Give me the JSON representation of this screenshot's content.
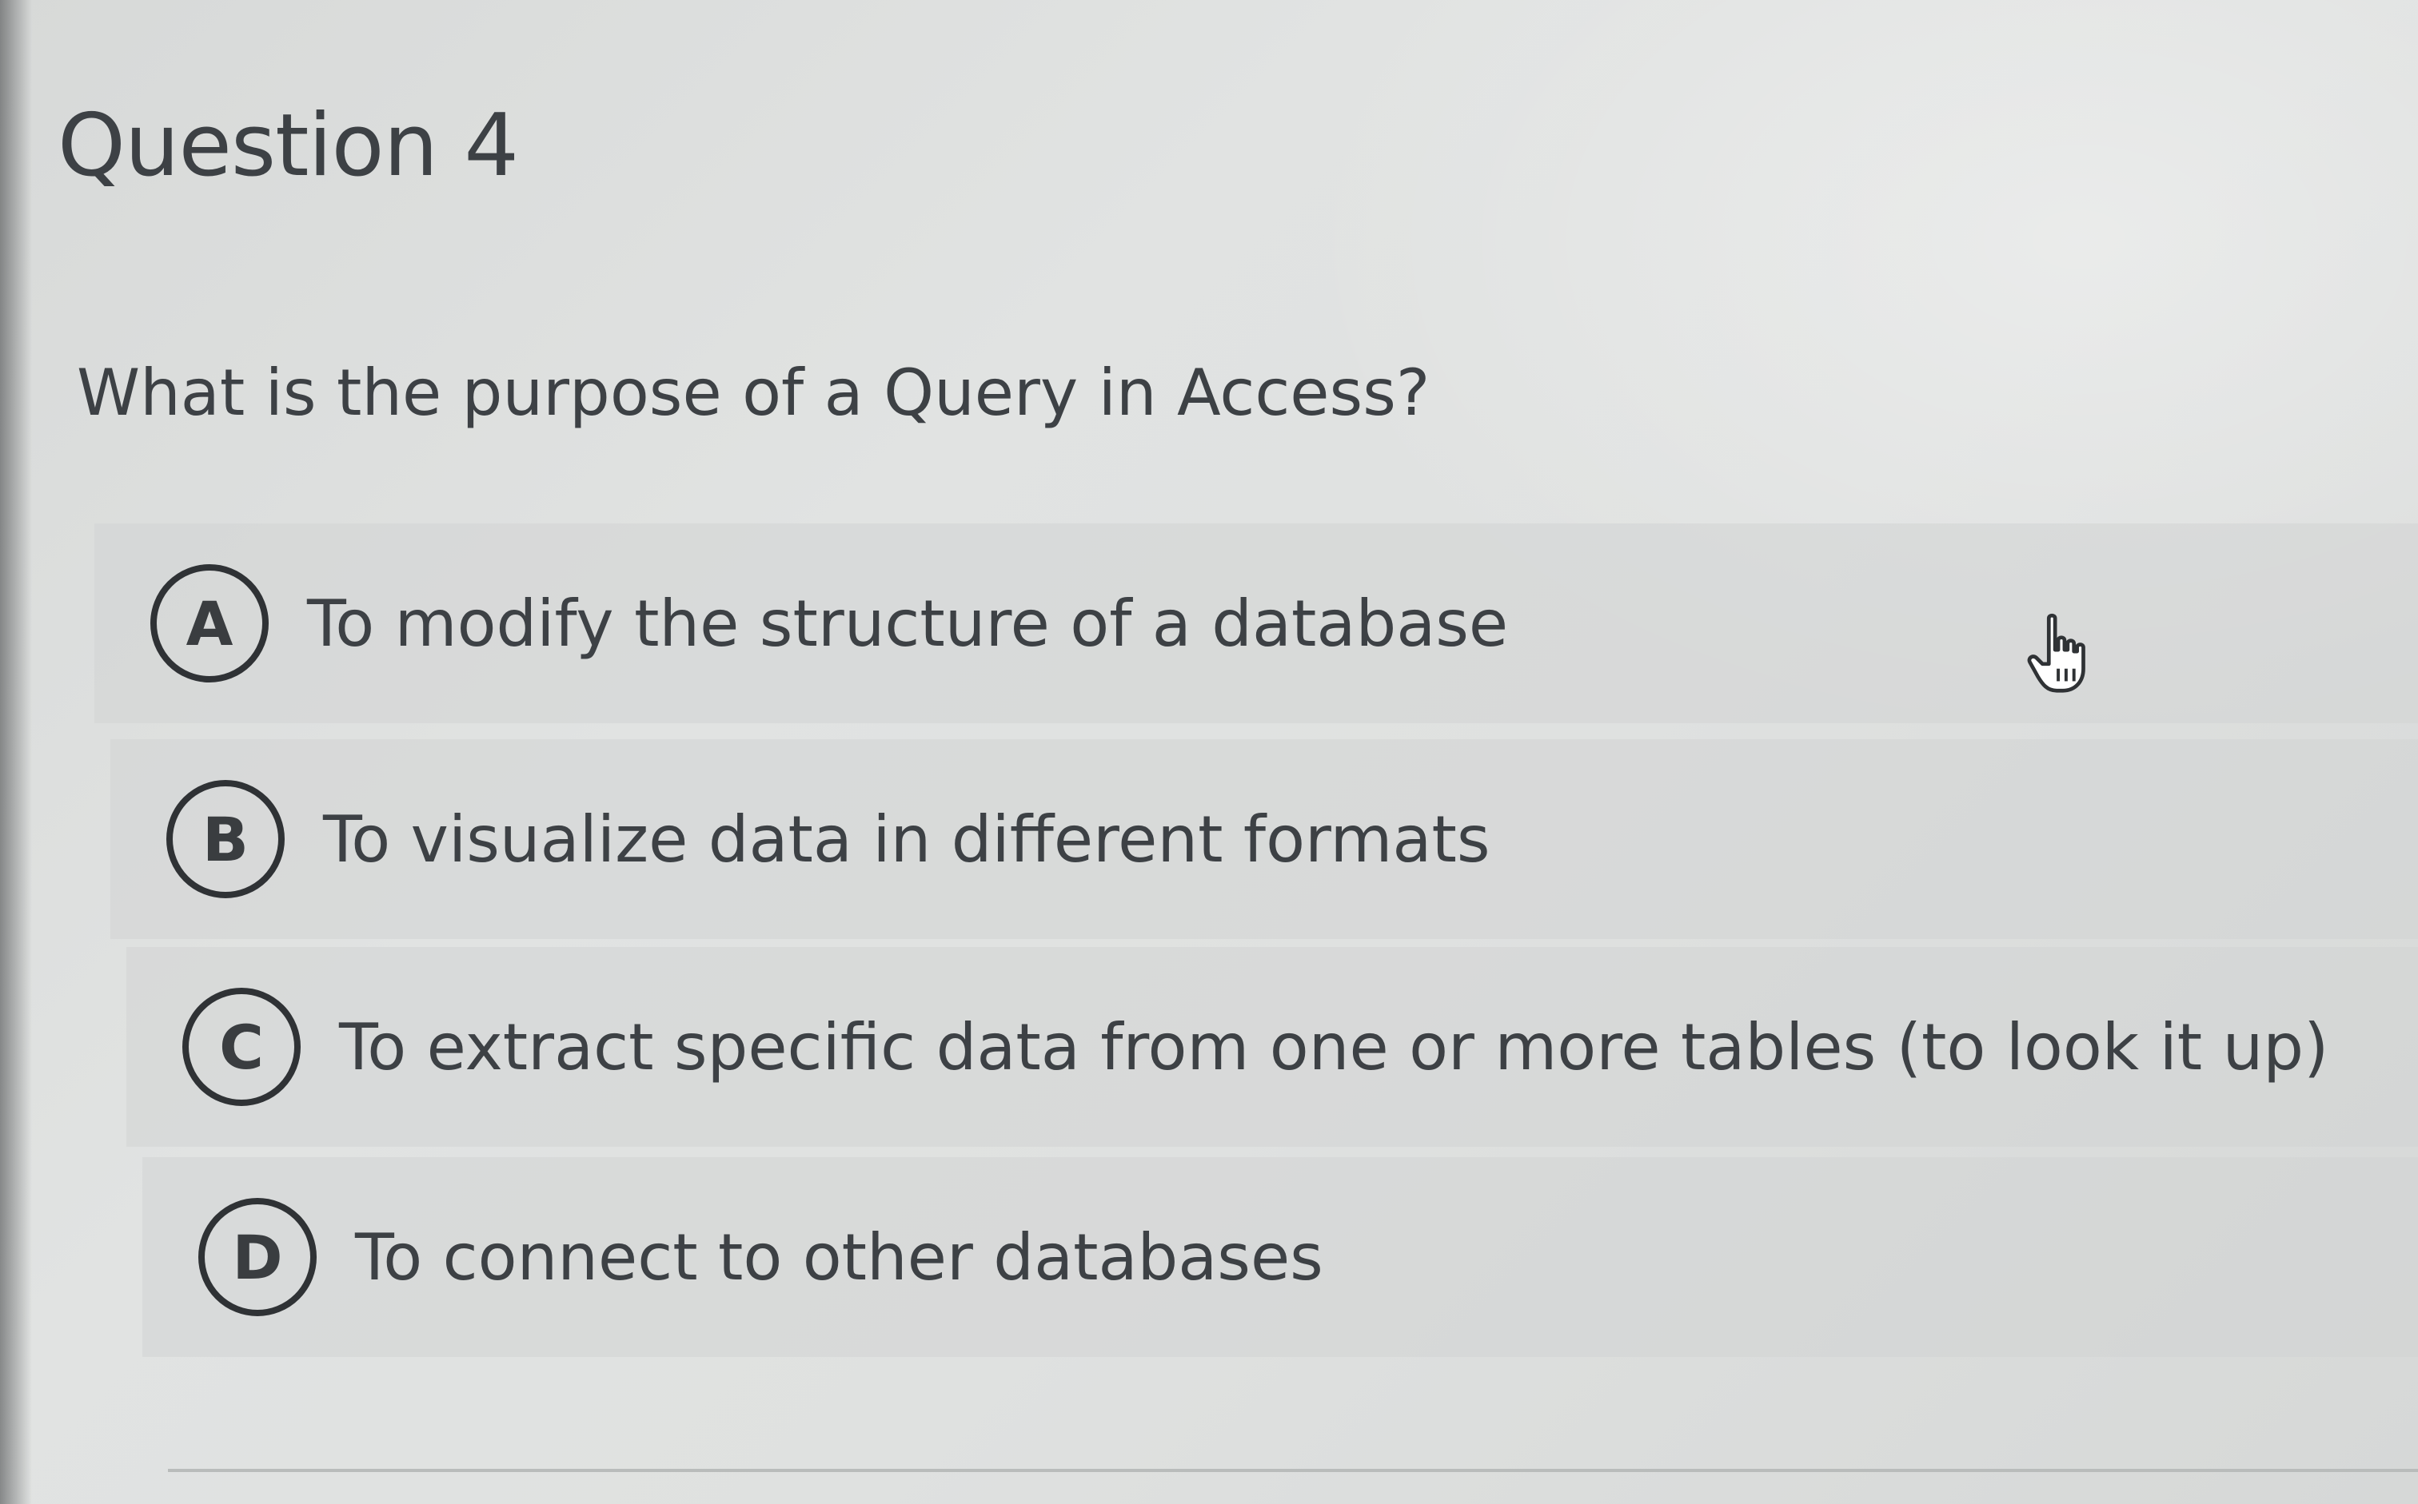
{
  "question": {
    "title": "Question 4",
    "prompt": "What is the purpose of a Query in Access?"
  },
  "options": [
    {
      "letter": "A",
      "text": "To modify the structure of a database"
    },
    {
      "letter": "B",
      "text": "To visualize data in different formats"
    },
    {
      "letter": "C",
      "text": "To extract specific data from one or more tables (to look it up)"
    },
    {
      "letter": "D",
      "text": "To connect to other databases"
    }
  ],
  "cursor": {
    "icon": "pointer-hand-icon"
  },
  "colors": {
    "background": "#dfe1e0",
    "text": "#3d4145",
    "badge_border": "#2f3235"
  }
}
